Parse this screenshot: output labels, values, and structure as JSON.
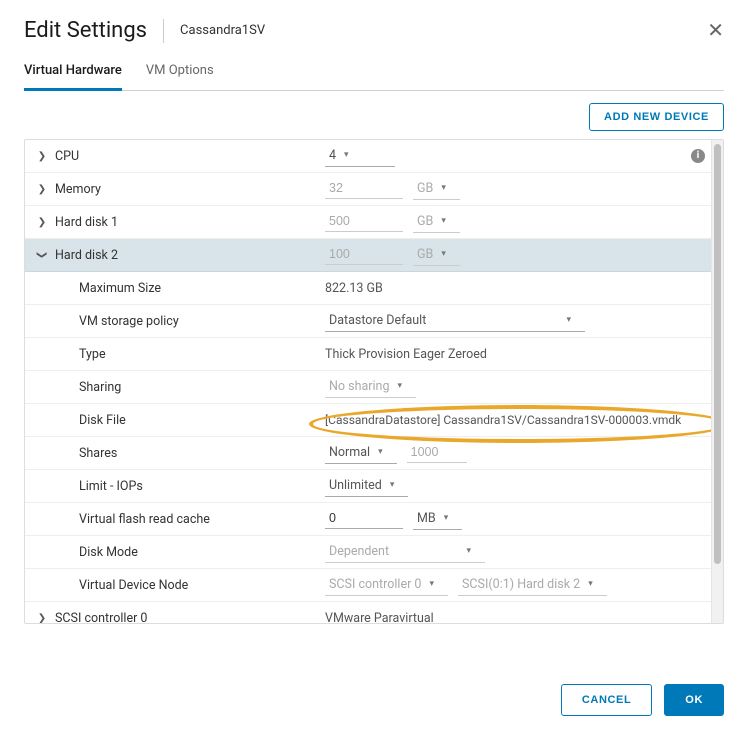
{
  "dialog": {
    "title": "Edit Settings",
    "vm_name": "Cassandra1SV"
  },
  "tabs": {
    "hardware": "Virtual Hardware",
    "vmoptions": "VM Options"
  },
  "toolbar": {
    "add_device": "ADD NEW DEVICE"
  },
  "rows": {
    "cpu": {
      "label": "CPU",
      "value": "4"
    },
    "memory": {
      "label": "Memory",
      "value": "32",
      "unit": "GB"
    },
    "hd1": {
      "label": "Hard disk 1",
      "value": "500",
      "unit": "GB"
    },
    "hd2": {
      "label": "Hard disk 2",
      "value": "100",
      "unit": "GB"
    },
    "hd2_children": {
      "maxsize": {
        "label": "Maximum Size",
        "value": "822.13 GB"
      },
      "policy": {
        "label": "VM storage policy",
        "value": "Datastore Default"
      },
      "type": {
        "label": "Type",
        "value": "Thick Provision Eager Zeroed"
      },
      "sharing": {
        "label": "Sharing",
        "value": "No sharing"
      },
      "diskfile": {
        "label": "Disk File",
        "value": "[CassandraDatastore] Cassandra1SV/Cassandra1SV-000003.vmdk"
      },
      "shares": {
        "label": "Shares",
        "level": "Normal",
        "value": "1000"
      },
      "limit": {
        "label": "Limit - IOPs",
        "value": "Unlimited"
      },
      "flashcache": {
        "label": "Virtual flash read cache",
        "value": "0",
        "unit": "MB"
      },
      "diskmode": {
        "label": "Disk Mode",
        "value": "Dependent"
      },
      "vdn": {
        "label": "Virtual Device Node",
        "controller": "SCSI controller 0",
        "node": "SCSI(0:1) Hard disk 2"
      }
    },
    "scsi0": {
      "label": "SCSI controller 0",
      "value": "VMware Paravirtual"
    }
  },
  "footer": {
    "cancel": "CANCEL",
    "ok": "OK"
  }
}
